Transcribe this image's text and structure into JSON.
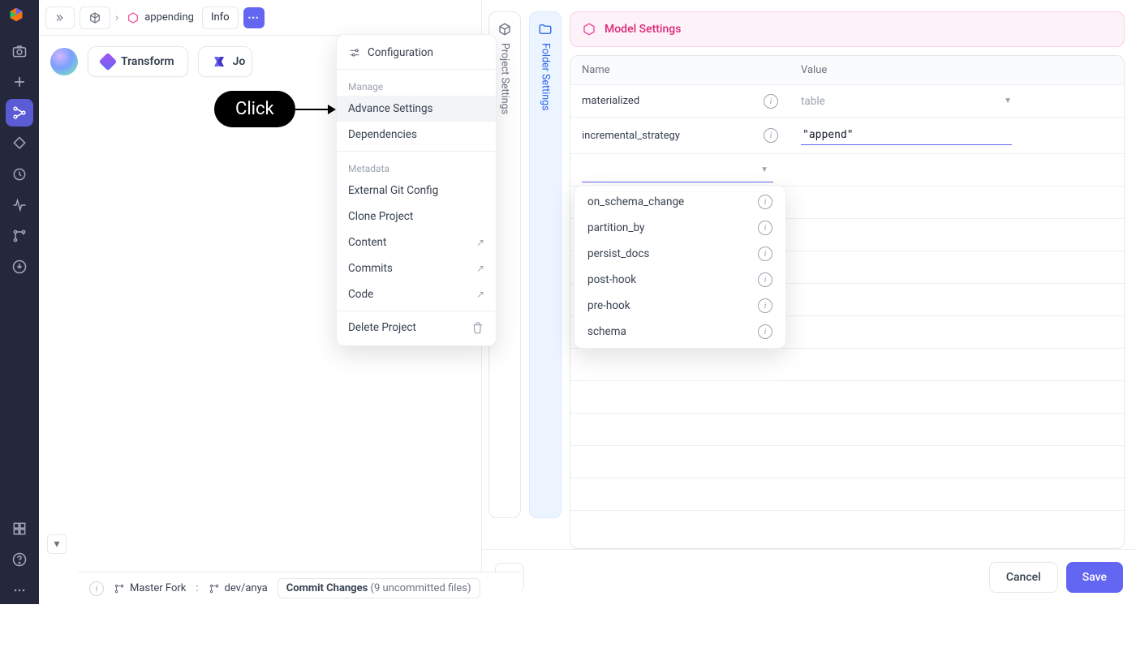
{
  "rail": {
    "items": [
      "camera",
      "plus",
      "graph",
      "diamond",
      "clock",
      "activity",
      "branch",
      "download"
    ],
    "bottom": [
      "widget",
      "help",
      "more"
    ]
  },
  "crumbs": {
    "project": "appending",
    "info": "Info"
  },
  "node_row": {
    "transform": "Transform",
    "join": "Jo"
  },
  "dropdown": {
    "config": "Configuration",
    "manage_head": "Manage",
    "advance": "Advance Settings",
    "deps": "Dependencies",
    "meta_head": "Metadata",
    "git": "External Git Config",
    "clone": "Clone Project",
    "content": "Content",
    "commits": "Commits",
    "code": "Code",
    "delete": "Delete Project"
  },
  "callout": {
    "label": "Click"
  },
  "vtabs": {
    "project": "Project Settings",
    "folder": "Folder Settings"
  },
  "panel": {
    "title": "Model Settings",
    "name_head": "Name",
    "value_head": "Value",
    "rows": [
      {
        "name": "materialized",
        "value_text": "table",
        "is_select": true
      },
      {
        "name": "incremental_strategy",
        "value_text": "\"append\"",
        "is_select": false
      }
    ]
  },
  "suggest": [
    "on_schema_change",
    "partition_by",
    "persist_docs",
    "post-hook",
    "pre-hook",
    "schema"
  ],
  "footer": {
    "cancel": "Cancel",
    "save": "Save"
  },
  "status": {
    "master": "Master Fork",
    "branch": "dev/anya",
    "commit_label": "Commit Changes",
    "commit_detail": "(9 uncommitted files)"
  }
}
